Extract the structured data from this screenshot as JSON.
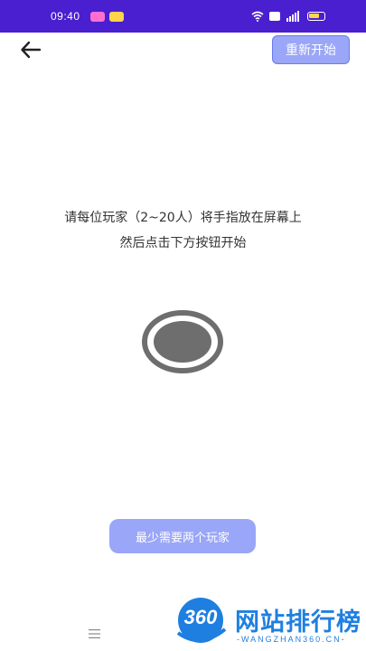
{
  "status_bar": {
    "time": "09:40",
    "background": "#4a1fd0",
    "app_icons": [
      "video-app-icon",
      "mail-app-icon"
    ],
    "indicators": [
      "wifi-icon",
      "hd-badge",
      "signal-icon",
      "battery-icon"
    ]
  },
  "header": {
    "back_icon": "arrow-left-icon",
    "restart_label": "重新开始"
  },
  "instructions": {
    "line1": "请每位玩家（2~20人）将手指放在屏幕上",
    "line2": "然后点击下方按钮开始"
  },
  "touch_target": {
    "icon": "finger-target-icon",
    "color": "#6e6e6e"
  },
  "footer": {
    "min_players_label": "最少需要两个玩家",
    "button_color": "#9aa6f7"
  },
  "nav": {
    "menu_icon": "menu-icon"
  },
  "watermark": {
    "logo_text": "360",
    "title": "网站排行榜",
    "url": "-WANGZHAN360.CN-",
    "color": "#1f7fe0"
  }
}
